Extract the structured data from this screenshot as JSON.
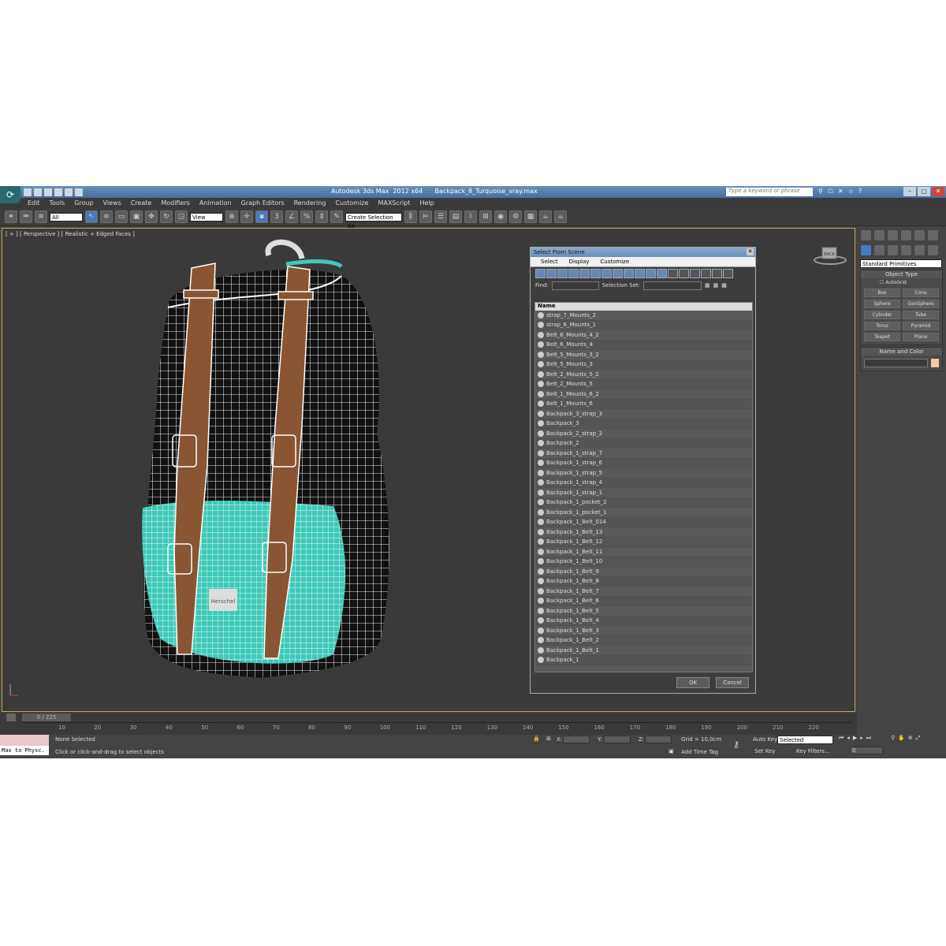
{
  "window": {
    "app_title": "Autodesk 3ds Max  2012 x64",
    "file_title": "Backpack_8_Turquoise_vray.max",
    "search_placeholder": "Type a keyword or phrase"
  },
  "menu": [
    "Edit",
    "Tools",
    "Group",
    "Views",
    "Create",
    "Modifiers",
    "Animation",
    "Graph Editors",
    "Rendering",
    "Customize",
    "MAXScript",
    "Help"
  ],
  "toolbar": {
    "selection_filter": "All",
    "ref_coord": "View",
    "named_selection": "Create Selection Se"
  },
  "viewport": {
    "label": "[ + ] [ Perspective ] [ Realistic + Edged Faces ]",
    "viewcube_label": "BACK",
    "model_badge": "Herschel"
  },
  "dialog": {
    "title": "Select From Scene",
    "menu": [
      "Select",
      "Display",
      "Customize"
    ],
    "find_label": "Find:",
    "selection_set_label": "Selection Set:",
    "column_header": "Name",
    "ok": "OK",
    "cancel": "Cancel",
    "items": [
      "strap_7_Mounts_2",
      "strap_6_Mounts_1",
      "Belt_6_Mounts_4_2",
      "Belt_6_Mounts_4",
      "Belt_5_Mounts_3_2",
      "Belt_5_Mounts_3",
      "Belt_2_Mounts_5_2",
      "Belt_2_Mounts_5",
      "Belt_1_Mounts_6_2",
      "Belt_1_Mounts_6",
      "Backpack_3_strap_3",
      "Backpack_3",
      "Backpack_2_strap_2",
      "Backpack_2",
      "Backpack_1_strap_7",
      "Backpack_1_strap_6",
      "Backpack_1_strap_5",
      "Backpack_1_strap_4",
      "Backpack_1_strap_1",
      "Backpack_1_pocket_2",
      "Backpack_1_pocket_1",
      "Backpack_1_Belt_014",
      "Backpack_1_Belt_13",
      "Backpack_1_Belt_12",
      "Backpack_1_Belt_11",
      "Backpack_1_Belt_10",
      "Backpack_1_Belt_9",
      "Backpack_1_Belt_8",
      "Backpack_1_Belt_7",
      "Backpack_1_Belt_6",
      "Backpack_1_Belt_5",
      "Backpack_1_Belt_4",
      "Backpack_1_Belt_3",
      "Backpack_1_Belt_2",
      "Backpack_1_Belt_1",
      "Backpack_1"
    ]
  },
  "command_panel": {
    "dropdown": "Standard Primitives",
    "object_type_header": "Object Type",
    "autogrid": "AutoGrid",
    "buttons": [
      "Box",
      "Cone",
      "Sphere",
      "GeoSphere",
      "Cylinder",
      "Tube",
      "Torus",
      "Pyramid",
      "Teapot",
      "Plane"
    ],
    "name_color_header": "Name and Color"
  },
  "timeline": {
    "slider": "0 / 225",
    "ticks": [
      "10",
      "20",
      "30",
      "40",
      "50",
      "60",
      "70",
      "80",
      "90",
      "100",
      "110",
      "120",
      "130",
      "140",
      "150",
      "160",
      "170",
      "180",
      "190",
      "200",
      "210",
      "220"
    ]
  },
  "status": {
    "maxscript": "Max to Physc.",
    "selection": "None Selected",
    "prompt": "Click or click-and-drag to select objects",
    "x_label": "X:",
    "y_label": "Y:",
    "z_label": "Z:",
    "grid": "Grid = 10,0cm",
    "auto_key": "Auto Key",
    "selected": "Selected",
    "set_key": "Set Key",
    "key_filters": "Key Filters...",
    "add_time_tag": "Add Time Tag",
    "frame": "0"
  },
  "colors": {
    "turquoise": "#3ec9b8",
    "strap_brown": "#8a5532",
    "viewport_border": "#c9a94a"
  }
}
